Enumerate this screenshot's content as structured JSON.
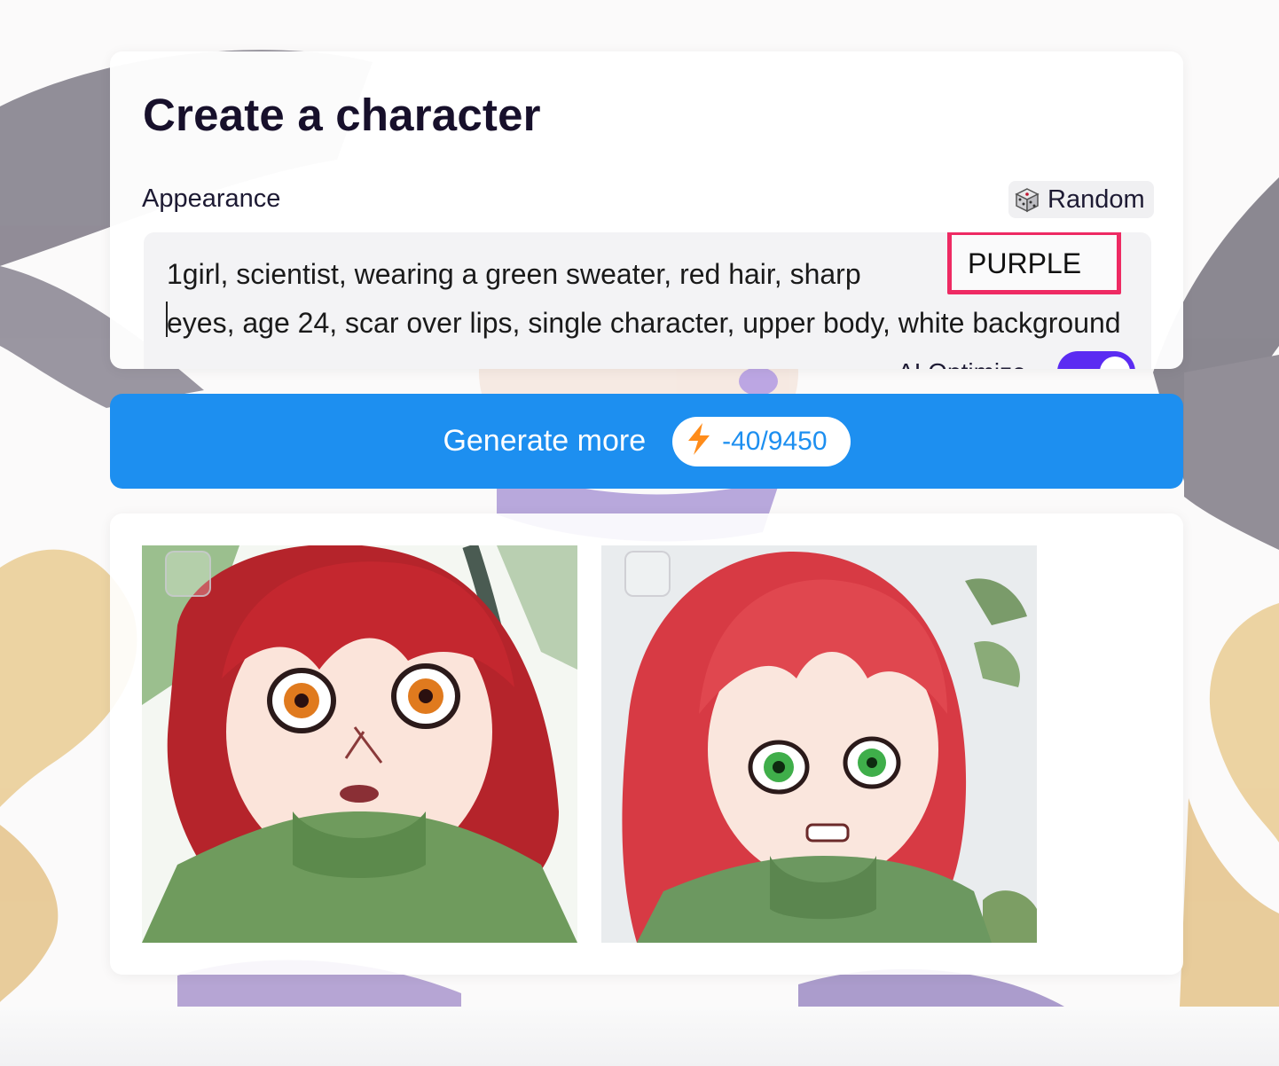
{
  "page": {
    "title": "Create a character"
  },
  "appearance": {
    "label": "Appearance",
    "random_button": {
      "label": "Random",
      "icon": "dice-icon"
    },
    "prompt": {
      "value": "1girl, scientist, wearing a green sweater, red hair, sharp  \neyes, age 24, scar over lips, single character, upper body, white background",
      "highlighted_word": "PURPLE"
    },
    "ai_optimize": {
      "label": "AI Optimize",
      "enabled": true
    }
  },
  "generate": {
    "label": "Generate more",
    "credits": "-40/9450",
    "credits_icon": "lightning-icon"
  },
  "results": {
    "images": [
      {
        "description": "red-haired girl with orange eyes in green turtleneck sweater",
        "selected": false
      },
      {
        "description": "red-haired girl with green eyes in green turtleneck sweater",
        "selected": false
      }
    ]
  },
  "colors": {
    "accent_blue": "#1d8ff0",
    "toggle_purple": "#5b2bf2",
    "highlight_pink": "#ee2a63"
  }
}
